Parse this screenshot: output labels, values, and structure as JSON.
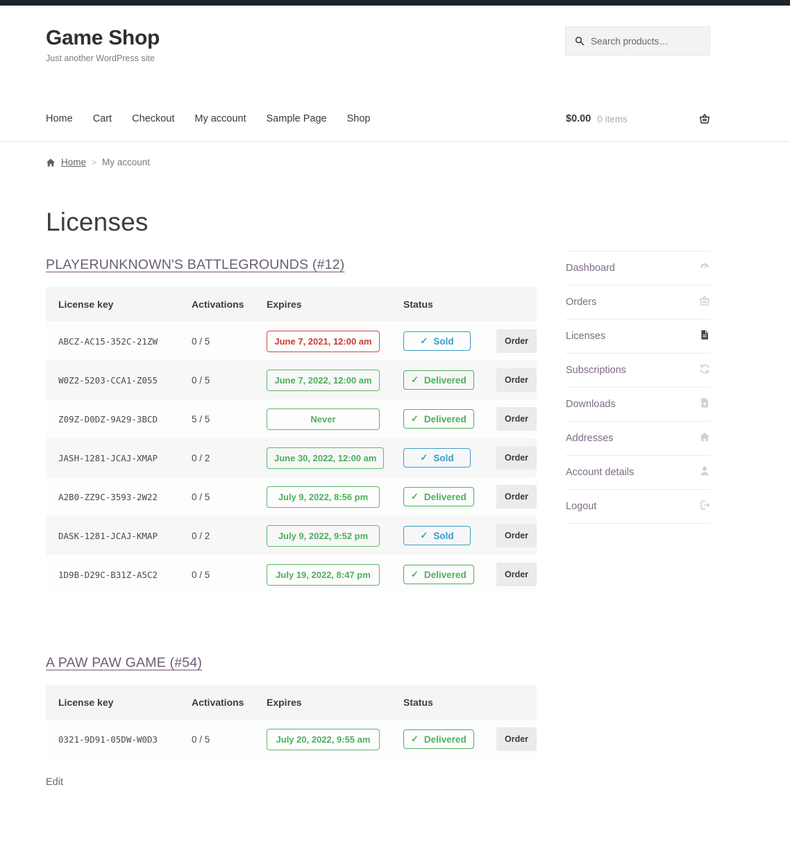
{
  "header": {
    "site_title": "Game Shop",
    "tagline": "Just another WordPress site",
    "search_placeholder": "Search products…"
  },
  "nav": {
    "items": [
      "Home",
      "Cart",
      "Checkout",
      "My account",
      "Sample Page",
      "Shop"
    ]
  },
  "cart": {
    "total": "$0.00",
    "count": "0 items"
  },
  "breadcrumb": {
    "home": "Home",
    "separator": ">",
    "current": "My account"
  },
  "page_title": "Licenses",
  "table_columns": [
    "License key",
    "Activations",
    "Expires",
    "Status"
  ],
  "license_sections": [
    {
      "heading": "PLAYERUNKNOWN'S BATTLEGROUNDS (#12)",
      "rows": [
        {
          "key": "ABCZ-AC15-352C-21ZW",
          "activations": "0 / 5",
          "expires": "June 7, 2021, 12:00 am",
          "expires_state": "expired",
          "status": "Sold",
          "order": "Order"
        },
        {
          "key": "W0Z2-5203-CCA1-Z055",
          "activations": "0 / 5",
          "expires": "June 7, 2022, 12:00 am",
          "expires_state": "valid",
          "status": "Delivered",
          "order": "Order"
        },
        {
          "key": "Z09Z-D0DZ-9A29-3BCD",
          "activations": "5 / 5",
          "expires": "Never",
          "expires_state": "valid",
          "status": "Delivered",
          "order": "Order"
        },
        {
          "key": "JASH-1281-JCAJ-XMAP",
          "activations": "0 / 2",
          "expires": "June 30, 2022, 12:00 am",
          "expires_state": "valid",
          "status": "Sold",
          "order": "Order"
        },
        {
          "key": "A2B0-ZZ9C-3593-2W22",
          "activations": "0 / 5",
          "expires": "July 9, 2022, 8:56 pm",
          "expires_state": "valid",
          "status": "Delivered",
          "order": "Order"
        },
        {
          "key": "DASK-1281-JCAJ-KMAP",
          "activations": "0 / 2",
          "expires": "July 9, 2022, 9:52 pm",
          "expires_state": "valid",
          "status": "Sold",
          "order": "Order"
        },
        {
          "key": "1D9B-D29C-B31Z-A5C2",
          "activations": "0 / 5",
          "expires": "July 19, 2022, 8:47 pm",
          "expires_state": "valid",
          "status": "Delivered",
          "order": "Order"
        }
      ]
    },
    {
      "heading": "A PAW PAW GAME (#54)",
      "rows": [
        {
          "key": "0321-9D91-05DW-W0D3",
          "activations": "0 / 5",
          "expires": "July 20, 2022, 9:55 am",
          "expires_state": "valid",
          "status": "Delivered",
          "order": "Order"
        }
      ]
    }
  ],
  "edit_link": "Edit",
  "sidebar": {
    "items": [
      {
        "label": "Dashboard",
        "icon": "dashboard-icon",
        "active": false
      },
      {
        "label": "Orders",
        "icon": "basket-icon",
        "active": false
      },
      {
        "label": "Licenses",
        "icon": "file-icon",
        "active": true
      },
      {
        "label": "Subscriptions",
        "icon": "refresh-icon",
        "active": false
      },
      {
        "label": "Downloads",
        "icon": "download-file-icon",
        "active": false
      },
      {
        "label": "Addresses",
        "icon": "home-icon",
        "active": false
      },
      {
        "label": "Account details",
        "icon": "user-icon",
        "active": false
      },
      {
        "label": "Logout",
        "icon": "logout-icon",
        "active": false
      }
    ]
  },
  "icons": {
    "check": "✓"
  },
  "colors": {
    "admin_bar": "#1d2327",
    "accent_purple": "#6b5d72",
    "green": "#4daf5c",
    "red": "#cc3a31",
    "teal": "#3a9bc7"
  }
}
